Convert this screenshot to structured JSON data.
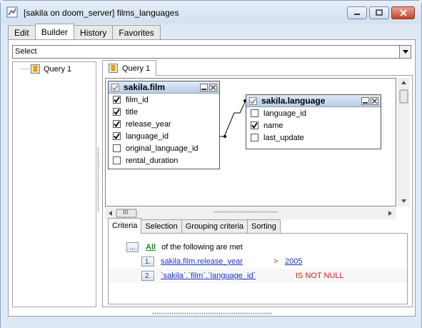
{
  "window": {
    "title": "[sakila on doom_server] films_languages"
  },
  "tabs": [
    "Edit",
    "Builder",
    "History",
    "Favorites"
  ],
  "active_tab": "Builder",
  "query_type": {
    "selected": "Select"
  },
  "tree": {
    "items": [
      "Query 1"
    ]
  },
  "query_tab": {
    "label": "Query 1"
  },
  "tables": [
    {
      "name": "sakila.film",
      "fields": [
        {
          "name": "film_id",
          "checked": true
        },
        {
          "name": "title",
          "checked": true
        },
        {
          "name": "release_year",
          "checked": true
        },
        {
          "name": "language_id",
          "checked": true
        },
        {
          "name": "original_language_id",
          "checked": false
        },
        {
          "name": "rental_duration",
          "checked": false
        }
      ]
    },
    {
      "name": "sakila.language",
      "fields": [
        {
          "name": "language_id",
          "checked": false
        },
        {
          "name": "name",
          "checked": true
        },
        {
          "name": "last_update",
          "checked": false
        }
      ]
    }
  ],
  "scroll": {
    "hscroll_grip": "III"
  },
  "criteria_tabs": [
    "Criteria",
    "Selection",
    "Grouping criteria",
    "Sorting"
  ],
  "criteria": {
    "ellipsis": "...",
    "all_label": "All",
    "header_text": "of the following are met",
    "conditions": [
      {
        "index": "1.",
        "field": "sakila.film.release_year",
        "operator": ">",
        "value": "2005"
      },
      {
        "index": "2.",
        "field": "`sakila`.`film`.`language_id`",
        "operator": "IS NOT NULL",
        "value": ""
      }
    ]
  },
  "colors": {
    "accent": "#1a35c8",
    "operator": "#d42020",
    "all": "#1f8a1f"
  }
}
